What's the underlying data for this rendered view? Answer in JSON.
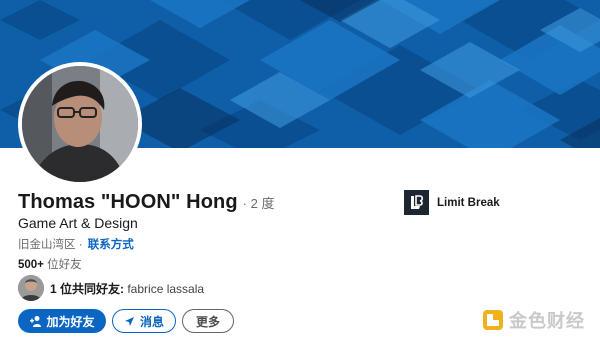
{
  "profile": {
    "name": "Thomas \"HOON\" Hong",
    "degree": "· 2 度",
    "headline": "Game Art & Design",
    "location": "旧金山湾区 ·",
    "contact_link": "联系方式",
    "connections_count": "500+",
    "connections_label": " 位好友"
  },
  "mutual": {
    "count_text": "1 位共同好友:",
    "names": " fabrice lassala"
  },
  "actions": {
    "connect_label": "加为好友",
    "message_label": "消息",
    "more_label": "更多"
  },
  "company": {
    "name": "Limit Break"
  },
  "watermark": {
    "text": "金色财经"
  },
  "colors": {
    "accent": "#0a66c2",
    "banner": "#0d5ca6",
    "company_logo_bg": "#1d2731"
  },
  "icons": {
    "connect": "add-person-icon",
    "message": "send-icon",
    "company": "limit-break-logo",
    "watermark": "golden-finance-logo"
  }
}
